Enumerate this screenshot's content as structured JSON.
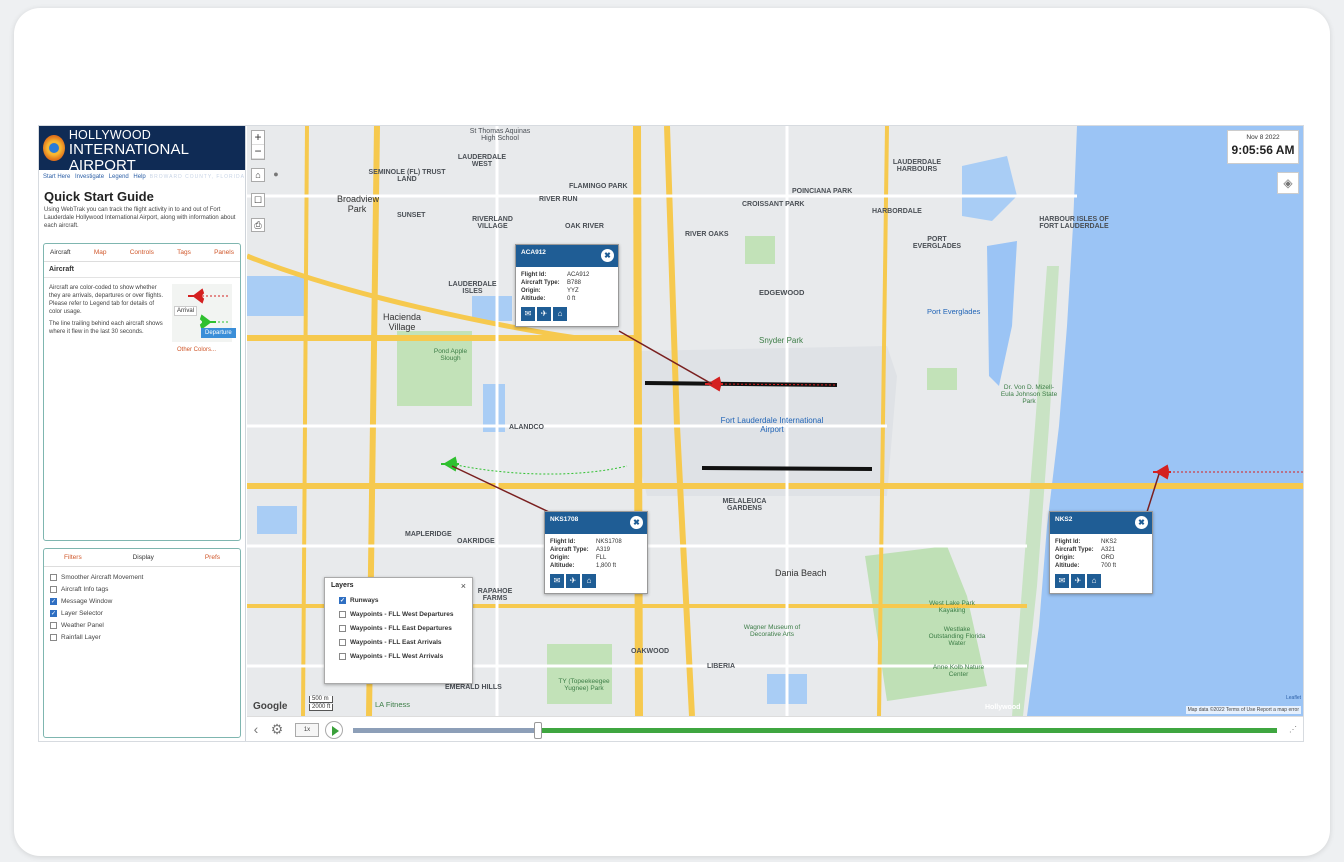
{
  "logo": {
    "line1": "FORT LAUDERDALE-HOLLYWOOD",
    "line2": "INTERNATIONAL AIRPORT",
    "line3": "BROWARD COUNTY, FLORIDA"
  },
  "top_links": [
    "Start Here",
    "Investigate",
    "Legend",
    "Help"
  ],
  "quick_start": {
    "title": "Quick Start Guide",
    "description": "Using WebTrak you can track the flight activity in to and out of Fort Lauderdale Hollywood International Airport, along with information about each aircraft."
  },
  "panel1": {
    "tabs": [
      "Aircraft",
      "Map",
      "Controls",
      "Tags",
      "Panels"
    ],
    "active_tab": "Aircraft",
    "heading": "Aircraft",
    "text1": "Aircraft are color-coded to show whether they are arrivals, departures or over flights. Please refer to Legend tab for details of color usage.",
    "text2": "The line trailing behind each aircraft shows where it flew in the last 30 seconds.",
    "arrival_label": "Arrival",
    "departure_label": "Departure",
    "other_colors": "Other Colors..."
  },
  "panel2": {
    "tabs": [
      "Filters",
      "Display",
      "Prefs"
    ],
    "active_tab": "Display",
    "options": [
      {
        "label": "Smoother Aircraft Movement",
        "checked": false
      },
      {
        "label": "Aircraft Info tags",
        "checked": false
      },
      {
        "label": "Message Window",
        "checked": true
      },
      {
        "label": "Layer Selector",
        "checked": true
      },
      {
        "label": "Weather Panel",
        "checked": false
      },
      {
        "label": "Rainfall Layer",
        "checked": false
      }
    ]
  },
  "clock": {
    "date": "Nov 8 2022",
    "time": "9:05:56 AM"
  },
  "map_labels": {
    "st_thomas": "St Thomas Aquinas High School",
    "seminole": "SEMINOLE (FL) TRUST LAND",
    "lauderdale_west": "LAUDERDALE WEST",
    "broadview": "Broadview Park",
    "flamingo": "FLAMINGO PARK",
    "river_run": "RIVER RUN",
    "sunset": "SUNSET",
    "riverland": "RIVERLAND VILLAGE",
    "oak_river": "OAK RIVER",
    "river_oaks": "RIVER OAKS",
    "croissant": "CROISSANT PARK",
    "poinciana": "POINCIANA PARK",
    "lauderdale_harbours": "LAUDERDALE HARBOURS",
    "harbordale": "HARBORDALE",
    "harbour_isles": "HARBOUR ISLES OF FORT LAUDERDALE",
    "port_everglades": "PORT EVERGLADES",
    "port_everglades_poi": "Port Everglades",
    "edgewood": "EDGEWOOD",
    "lauderdale_isles": "LAUDERDALE ISLES",
    "hacienda": "Hacienda Village",
    "pond_apple": "Pond Apple Slough",
    "snyder": "Snyder Park",
    "airport": "Fort Lauderdale International Airport",
    "alandco": "ALANDCO",
    "dr_von_d": "Dr. Von D. Mizell-Eula Johnson State Park",
    "melaleuca": "MELALEUCA GARDENS",
    "mapleridge": "MAPLERIDGE",
    "oakridge": "OAKRIDGE",
    "dania_beach": "Dania Beach",
    "west_lake": "West Lake Park Kayaking",
    "westlake": "Westlake Outstanding Florida Water",
    "wagner": "Wagner Museum of Decorative Arts",
    "anne_kolb": "Anne Kolb Nature Center",
    "oakwood": "OAKWOOD",
    "liberia": "LIBERIA",
    "emerald_hills": "EMERALD HILLS",
    "topeekeegee": "TY (Topeekeegee Yugnee) Park",
    "la_fitness": "LA Fitness",
    "rapahoe_farms": "RAPAHOE FARMS",
    "hollywood": "Hollywood"
  },
  "flights": [
    {
      "id": "ACA912",
      "type": "B788",
      "origin": "YYZ",
      "altitude": "0 ft"
    },
    {
      "id": "NKS1708",
      "type": "A319",
      "origin": "FLL",
      "altitude": "1,800 ft"
    },
    {
      "id": "NKS2",
      "type": "A321",
      "origin": "ORD",
      "altitude": "700 ft"
    }
  ],
  "flight_field_labels": {
    "id": "Flight Id:",
    "type": "Aircraft Type:",
    "origin": "Origin:",
    "altitude": "Altitude:"
  },
  "layers": {
    "title": "Layers",
    "close": "×",
    "items": [
      {
        "label": "Runways",
        "checked": true
      },
      {
        "label": "Waypoints - FLL West Departures",
        "checked": false
      },
      {
        "label": "Waypoints - FLL East Departures",
        "checked": false
      },
      {
        "label": "Waypoints - FLL East Arrivals",
        "checked": false
      },
      {
        "label": "Waypoints - FLL West Arrivals",
        "checked": false
      }
    ]
  },
  "map_footer": {
    "google": "Google",
    "scale1": "500 m",
    "scale2": "2000 ft",
    "attribution": "Map data ©2022   Terms of Use   Report a map error",
    "leaflet": "Leaflet"
  },
  "timeline": {
    "speed": "1x"
  },
  "colors": {
    "arrival": "#d42020",
    "departure": "#2fc02f",
    "header": "#0f2b55",
    "card_header": "#1f5d95",
    "water": "#9bc4f5",
    "road": "#f6c94e"
  }
}
